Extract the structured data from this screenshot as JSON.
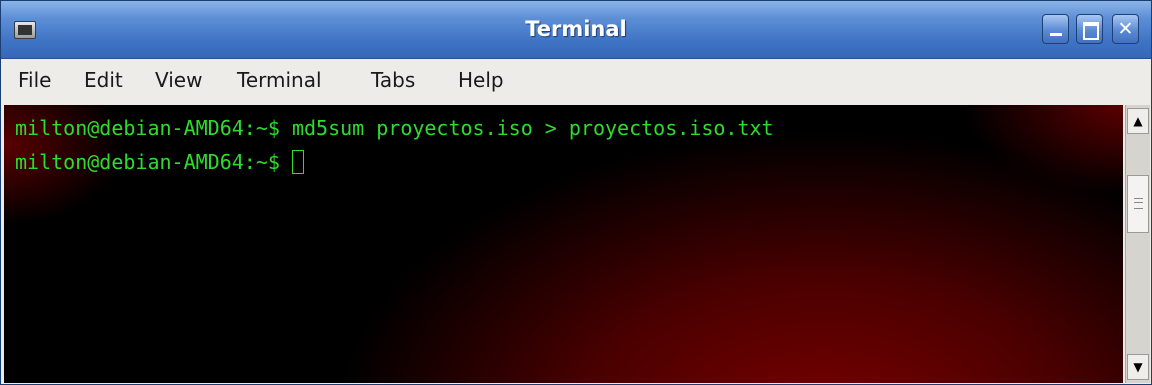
{
  "window": {
    "title": "Terminal"
  },
  "menu": [
    {
      "label": "File"
    },
    {
      "label": "Edit"
    },
    {
      "label": "View"
    },
    {
      "label": "Terminal"
    },
    {
      "label": "Tabs"
    },
    {
      "label": "Help"
    }
  ],
  "terminal": {
    "lines": [
      "milton@debian-AMD64:~$ md5sum proyectos.iso > proyectos.iso.txt",
      "milton@debian-AMD64:~$ "
    ]
  },
  "colors": {
    "terminal_text": "#2ddc2d",
    "titlebar": "#3f74c5"
  },
  "icons": {
    "app": "terminal-icon",
    "minimize": "minimize-icon",
    "maximize": "maximize-icon",
    "close": "close-icon",
    "scroll_up": "arrow-up-icon",
    "scroll_down": "arrow-down-icon"
  }
}
